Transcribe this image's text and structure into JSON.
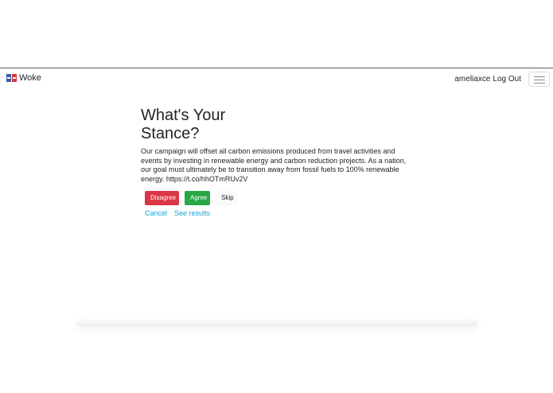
{
  "navbar": {
    "brand": "Woke",
    "username": "ameliaxce",
    "logout_label": "Log Out"
  },
  "main": {
    "title": "What's Your Stance?",
    "statement": "Our campaign will offset all carbon emissions produced from travel activities and events by investing in renewable energy and carbon reduction projects. As a nation, our goal must ultimately be to transition away from fossil fuels to 100% renewable energy. https://t.co/hhOTmRUv2V",
    "buttons": {
      "disagree": "Disagree",
      "agree": "Agree",
      "skip": "Skip"
    },
    "links": {
      "cancel": "Cancel",
      "see_results": "See results"
    }
  },
  "colors": {
    "disagree": "#dc3545",
    "agree": "#28a745",
    "link": "#17a2d8"
  }
}
